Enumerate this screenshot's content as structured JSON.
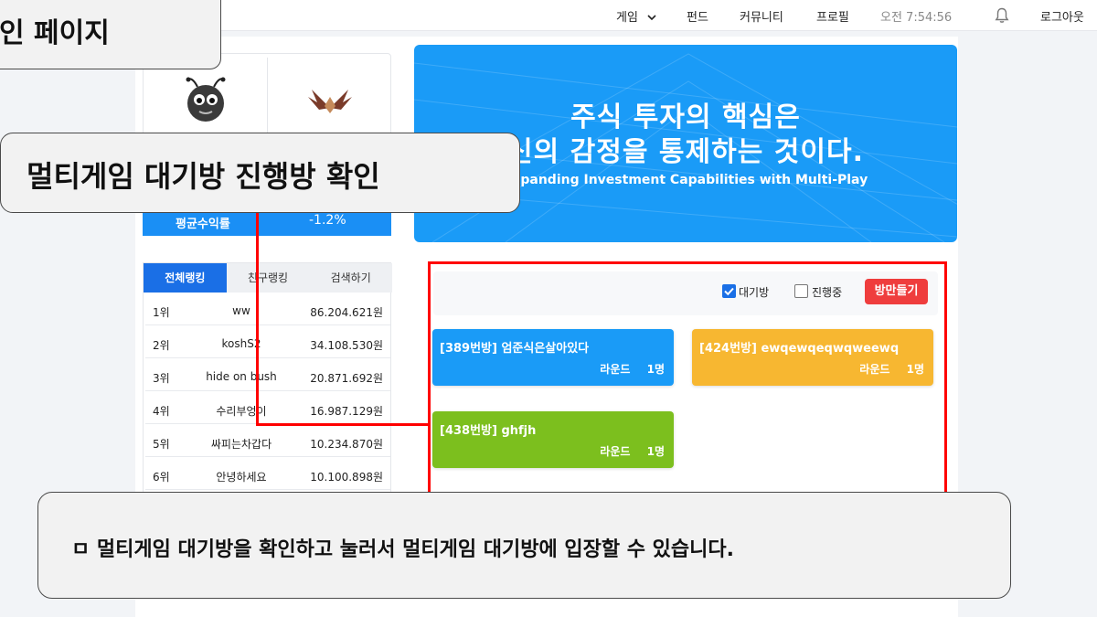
{
  "nav": {
    "game": "게임",
    "fund": "펀드",
    "community": "커뮤니티",
    "profile": "프로필",
    "time": "오전 7:54:56",
    "logout": "로그아웃"
  },
  "profile_card": {
    "stat_label": "평균수익률",
    "stat_value": "-1.2%"
  },
  "banner": {
    "line1": "주식 투자의 핵심은",
    "line2": "신의 감정을 통제하는 것이다.",
    "subtitle": "Expanding Investment Capabilities with Multi-Play",
    "color": "#1a9bf7"
  },
  "ranking": {
    "tabs": [
      {
        "label": "전체랭킹",
        "active": true
      },
      {
        "label": "친구랭킹",
        "active": false
      },
      {
        "label": "검색하기",
        "active": false
      }
    ],
    "rows": [
      {
        "rank": "1위",
        "name": "ww",
        "value": "86.204.621원"
      },
      {
        "rank": "2위",
        "name": "koshS2",
        "value": "34.108.530원"
      },
      {
        "rank": "3위",
        "name": "hide on bush",
        "value": "20.871.692원"
      },
      {
        "rank": "4위",
        "name": "수리부엉이",
        "value": "16.987.129원"
      },
      {
        "rank": "5위",
        "name": "싸피는차갑다",
        "value": "10.234.870원"
      },
      {
        "rank": "6위",
        "name": "안녕하세요",
        "value": "10.100.898원"
      }
    ]
  },
  "rooms_panel": {
    "filter_waiting_label": "대기방",
    "filter_waiting_checked": true,
    "filter_playing_label": "진행중",
    "filter_playing_checked": false,
    "make_room_label": "방만들기",
    "rooms": [
      {
        "title": "[389번방] 엄준식은살아있다",
        "round_label": "라운드",
        "players": "1명",
        "color": "#1a9bf7"
      },
      {
        "title": "[424번방] ewqewqeqwqweewq",
        "round_label": "라운드",
        "players": "1명",
        "color": "#f7b731"
      },
      {
        "title": "[438번방] ghfjh",
        "round_label": "라운드",
        "players": "1명",
        "color": "#7cbf1e"
      }
    ]
  },
  "callouts": {
    "top": "인 페이지",
    "middle": "멀티게임 대기방 진행방 확인",
    "bottom": "ㅁ 멀티게임 대기방을 확인하고 눌러서 멀티게임 대기방에 입장할 수 있습니다."
  },
  "colors": {
    "highlight": "#ff0000",
    "primary": "#1a6fe6",
    "danger": "#ef3d3d"
  }
}
